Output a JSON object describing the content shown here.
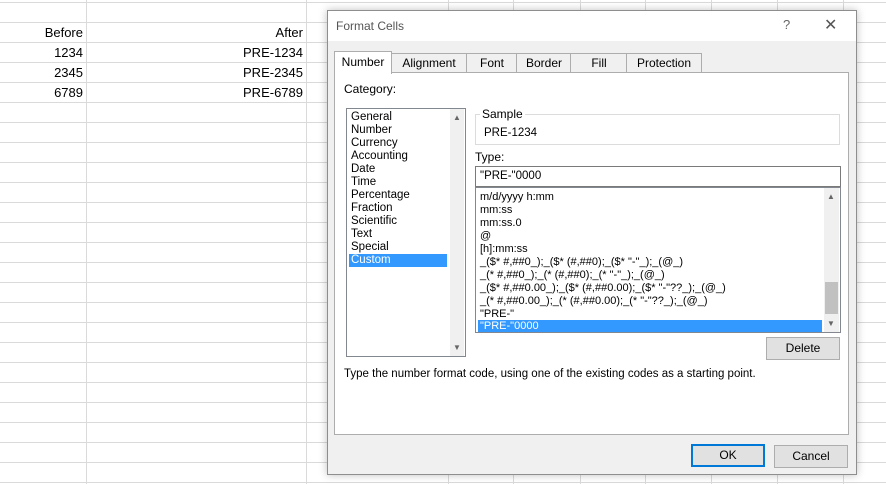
{
  "sheet": {
    "headers": {
      "before": "Before",
      "after": "After"
    },
    "rows": [
      {
        "before": "1234",
        "after": "PRE-1234"
      },
      {
        "before": "2345",
        "after": "PRE-2345"
      },
      {
        "before": "6789",
        "after": "PRE-6789"
      }
    ]
  },
  "dialog": {
    "title": "Format Cells",
    "help": "?",
    "close": "✕",
    "tabs": [
      "Number",
      "Alignment",
      "Font",
      "Border",
      "Fill",
      "Protection"
    ],
    "category_label": "Category:",
    "categories": [
      "General",
      "Number",
      "Currency",
      "Accounting",
      "Date",
      "Time",
      "Percentage",
      "Fraction",
      "Scientific",
      "Text",
      "Special",
      "Custom"
    ],
    "selected_category": "Custom",
    "sample_label": "Sample",
    "sample_value": "PRE-1234",
    "type_label": "Type:",
    "type_value": "\"PRE-\"0000",
    "formats": [
      "m/d/yyyy h:mm",
      "mm:ss",
      "mm:ss.0",
      "@",
      "[h]:mm:ss",
      "_($* #,##0_);_($* (#,##0);_($* \"-\"_);_(@_)",
      "_(* #,##0_);_(* (#,##0);_(* \"-\"_);_(@_)",
      "_($* #,##0.00_);_($* (#,##0.00);_($* \"-\"??_);_(@_)",
      "_(* #,##0.00_);_(* (#,##0.00);_(* \"-\"??_);_(@_)",
      "\"PRE-\"",
      "\"PRE-\"0000"
    ],
    "selected_format": "\"PRE-\"0000",
    "delete_label": "Delete",
    "description": "Type the number format code, using one of the existing codes as a starting point.",
    "ok_label": "OK",
    "cancel_label": "Cancel"
  }
}
